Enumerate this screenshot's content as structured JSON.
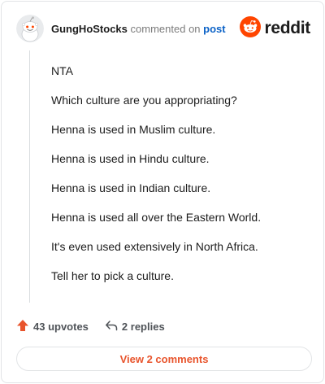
{
  "comment": {
    "author": "GungHoStocks",
    "verb": "commented on",
    "post_link": "post",
    "brand": "reddit",
    "brand_color": "#ff4500",
    "body": [
      "NTA",
      "Which culture are you appropriating?",
      "Henna is used in Muslim culture.",
      "Henna is used in Hindu culture.",
      "Henna is used in Indian culture.",
      "Henna is used all over the Eastern World.",
      "It's even used extensively in North Africa.",
      "Tell her to pick a culture."
    ]
  },
  "footer": {
    "upvotes": "43 upvotes",
    "replies": "2 replies",
    "view_button": "View 2 comments",
    "accent_color": "#e8542c"
  },
  "icons": {
    "avatar": "snoo-avatar-icon",
    "brand": "reddit-logo-icon",
    "upvote": "upvote-arrow-icon",
    "reply": "reply-arrow-icon"
  }
}
